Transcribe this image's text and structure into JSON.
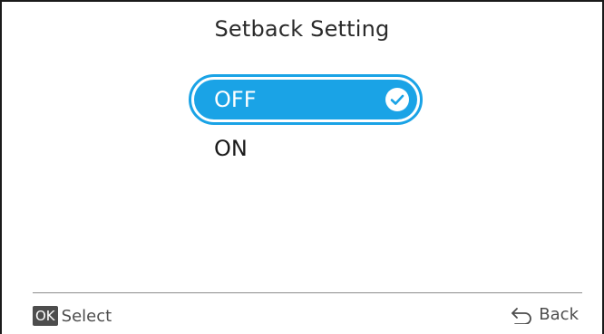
{
  "screen": {
    "title": "Setback Setting"
  },
  "options": [
    {
      "label": "OFF",
      "selected": true
    },
    {
      "label": "ON",
      "selected": false
    }
  ],
  "footer": {
    "ok_badge": "OK",
    "select_label": "Select",
    "back_label": "Back",
    "back_icon": "back-arrow-icon"
  },
  "colors": {
    "accent": "#1aa3e6",
    "text": "#1a1a1a",
    "muted": "#4d4d4d"
  }
}
